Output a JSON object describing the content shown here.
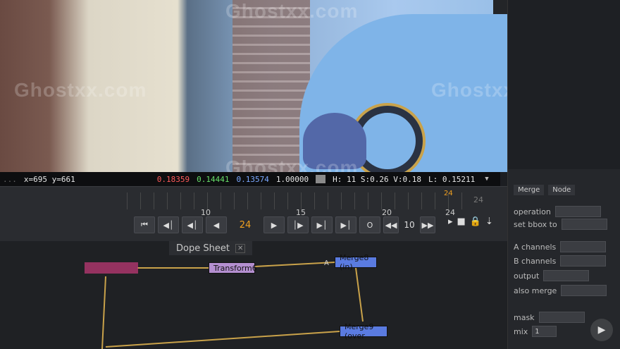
{
  "viewer": {
    "info": {
      "format_label": "...",
      "coords": "x=695 y=661",
      "red": "0.18359",
      "green": "0.14441",
      "blue": "0.13574",
      "alpha": "1.00000",
      "hsv": "H: 11 S:0.26 V:0.18",
      "luminance": "L: 0.15211"
    },
    "watermarks": [
      "Ghostxx.com",
      "Ghostxx.com",
      "Ghostxx.com",
      "Ghostxx.com",
      "Ghostxx.com",
      "Ghostxx.com"
    ]
  },
  "timeline": {
    "tick_labels": [
      "10",
      "15",
      "20",
      "24"
    ],
    "current_marker": "24",
    "end_frame": "24",
    "current_frame": "24",
    "step": "10",
    "controls": {
      "first": "⏮",
      "prev_key": "◀│",
      "prev_frame": "◀│",
      "play_back": "◀",
      "play_fwd": "▶",
      "next_frame": "│▶",
      "next_key": "▶│",
      "last": "▶│",
      "o": "O",
      "step_back": "◀◀",
      "step_fwd": "▶▶"
    },
    "right_icons": [
      "▸",
      "■",
      "🔒",
      "⇣"
    ]
  },
  "nodegraph": {
    "tab_label": "Dope Sheet",
    "tab_close": "✕",
    "nodes": {
      "transform": "Transform6",
      "merge8": "Merge8 (in)",
      "merge9": "Merge9 (over"
    },
    "input_a": "A"
  },
  "props": {
    "tabs": [
      "Merge",
      "Node"
    ],
    "rows": [
      {
        "label": "operation",
        "value": ""
      },
      {
        "label": "set bbox to",
        "value": ""
      },
      {
        "label": "A channels",
        "value": ""
      },
      {
        "label": "B channels",
        "value": ""
      },
      {
        "label": "output",
        "value": ""
      },
      {
        "label": "also merge",
        "value": ""
      }
    ],
    "mask_label": "mask",
    "mix_label": "mix",
    "mix_value": "1"
  },
  "colors": {
    "accent_orange": "#f0a020",
    "node_transform": "#b48fd0",
    "node_merge": "#5a7be0",
    "red": "#ff5a5a",
    "green": "#67e06a",
    "blue": "#7aa8ff"
  }
}
